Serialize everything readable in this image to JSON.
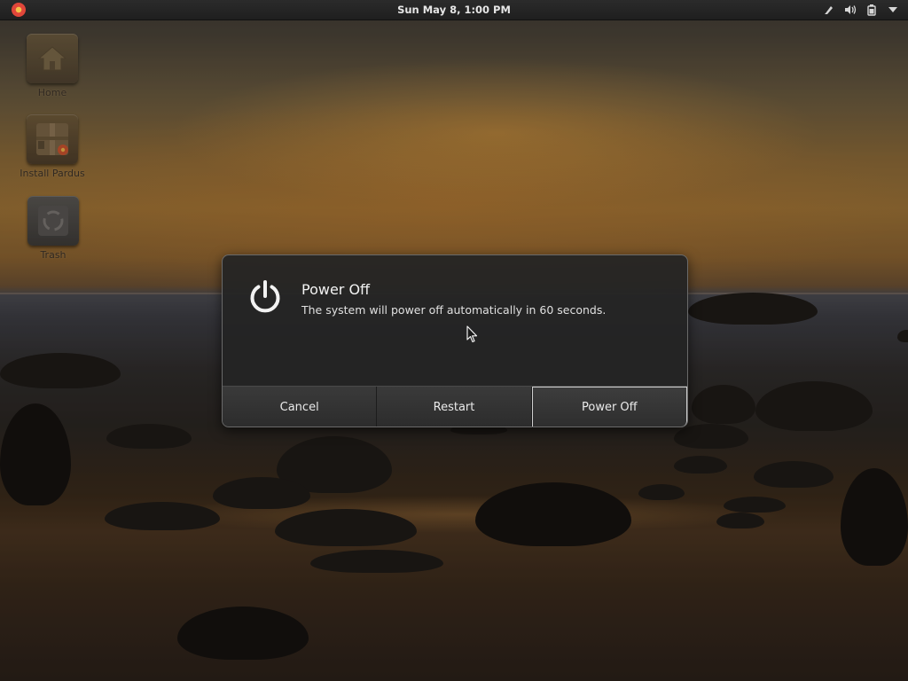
{
  "topbar": {
    "clock": "Sun May  8,  1:00 PM",
    "activities_icon": "pardus-flower-icon",
    "tray_icons": [
      "pen-icon",
      "volume-icon",
      "battery-icon",
      "menu-arrow-icon"
    ]
  },
  "desktop": {
    "icons": [
      {
        "label": "Home",
        "icon": "home-folder-icon"
      },
      {
        "label": "Install Pardus",
        "icon": "installer-package-icon"
      },
      {
        "label": "Trash",
        "icon": "trash-icon"
      }
    ]
  },
  "dialog": {
    "icon": "power-icon",
    "title": "Power Off",
    "message": "The system will power off automatically in 60 seconds.",
    "buttons": {
      "cancel": "Cancel",
      "restart": "Restart",
      "power_off": "Power Off"
    },
    "default_button": "power_off"
  },
  "colors": {
    "dialog_bg": "#242424",
    "topbar_bg": "#252525",
    "text_primary": "#f2f2f2"
  }
}
